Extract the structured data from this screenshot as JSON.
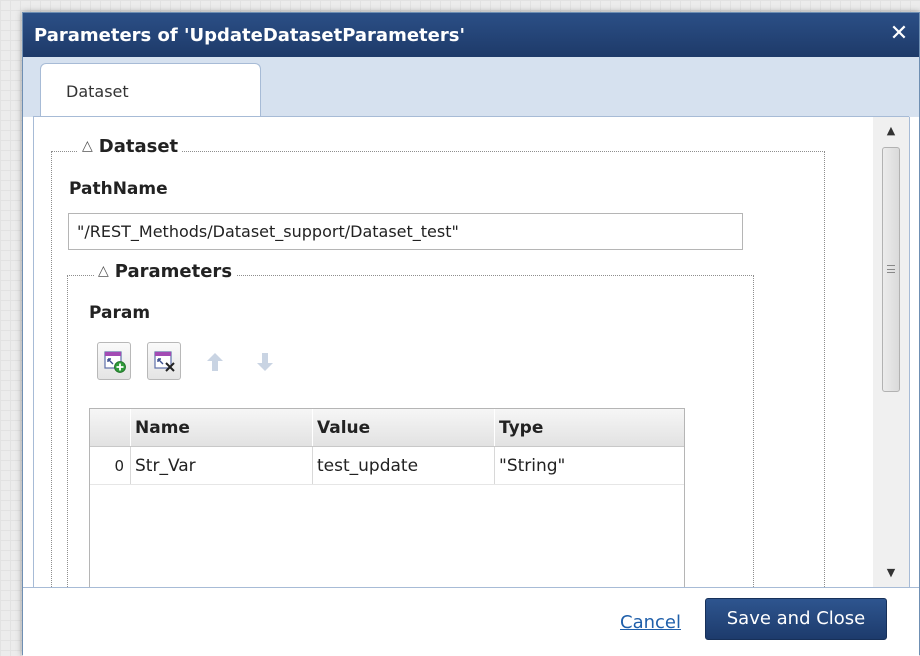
{
  "dialog": {
    "title": "Parameters of 'UpdateDatasetParameters'",
    "close_symbol": "✕"
  },
  "tabs": [
    {
      "label": "Dataset",
      "selected": true
    }
  ],
  "dataset_section": {
    "legend": "Dataset",
    "collapse_icon": "△",
    "path_label": "PathName",
    "path_value": "\"/REST_Methods/Dataset_support/Dataset_test\""
  },
  "parameters_section": {
    "legend": "Parameters",
    "collapse_icon": "△",
    "param_label": "Param",
    "toolbar": [
      {
        "icon": "add-row-icon",
        "enabled": true
      },
      {
        "icon": "delete-row-icon",
        "enabled": true
      },
      {
        "icon": "move-up-icon",
        "enabled": false
      },
      {
        "icon": "move-down-icon",
        "enabled": false
      }
    ],
    "grid": {
      "columns": [
        "Name",
        "Value",
        "Type"
      ],
      "rows": [
        {
          "index": "0",
          "name": "Str_Var",
          "value": "test_update",
          "type": "\"String\""
        }
      ]
    }
  },
  "footer": {
    "cancel_label": "Cancel",
    "save_label": "Save and Close"
  },
  "colors": {
    "title_bar": "#1e3a69",
    "tab_strip": "#d6e1ef",
    "link": "#1f5faa",
    "primary_button": "#1d3b6c"
  }
}
